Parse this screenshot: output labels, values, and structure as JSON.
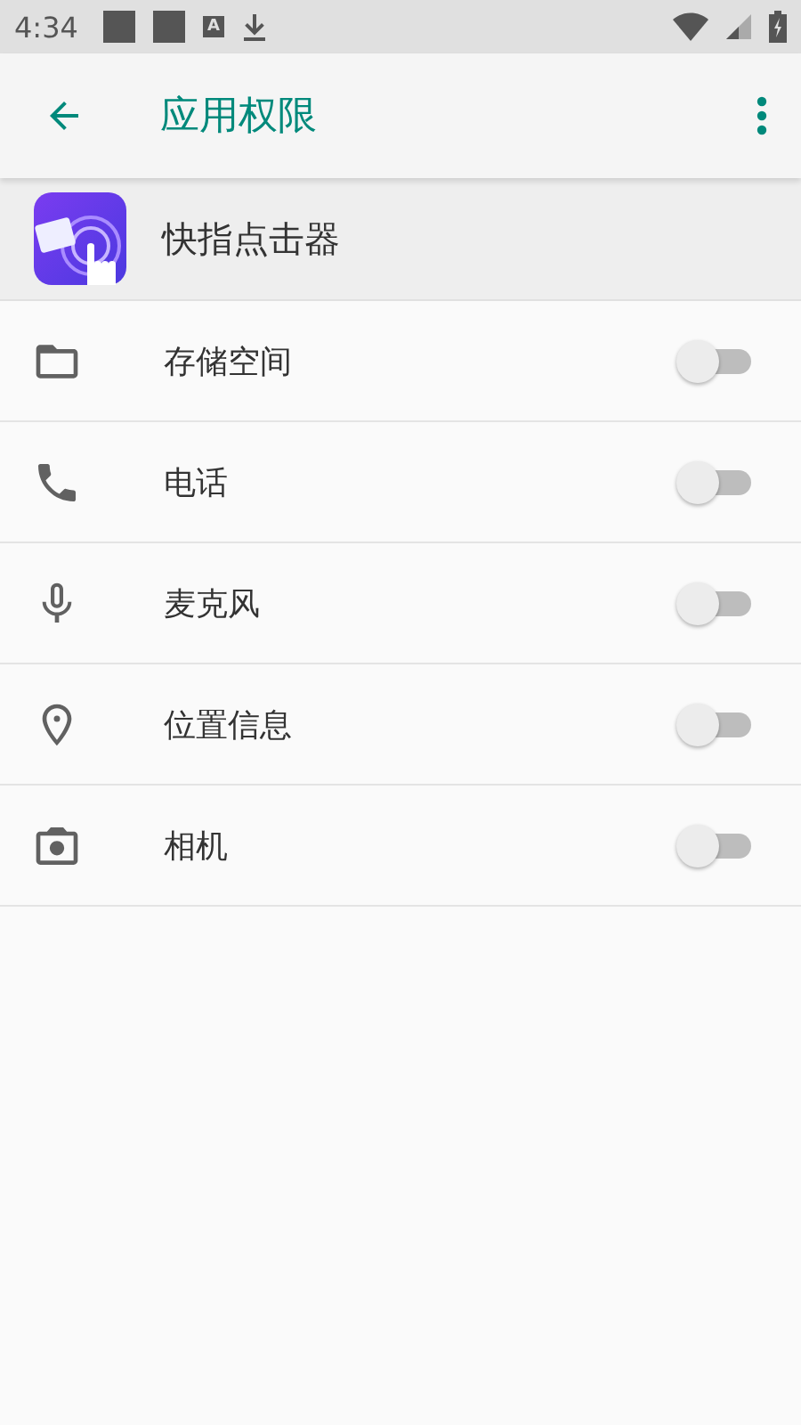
{
  "status_bar": {
    "time": "4:34",
    "badge_letter": "A"
  },
  "toolbar": {
    "title": "应用权限"
  },
  "app": {
    "name": "快指点击器"
  },
  "permissions": [
    {
      "kind": "folder",
      "label": "存储空间",
      "on": false
    },
    {
      "kind": "phone",
      "label": "电话",
      "on": false
    },
    {
      "kind": "mic",
      "label": "麦克风",
      "on": false
    },
    {
      "kind": "location",
      "label": "位置信息",
      "on": false
    },
    {
      "kind": "camera",
      "label": "相机",
      "on": false
    }
  ]
}
